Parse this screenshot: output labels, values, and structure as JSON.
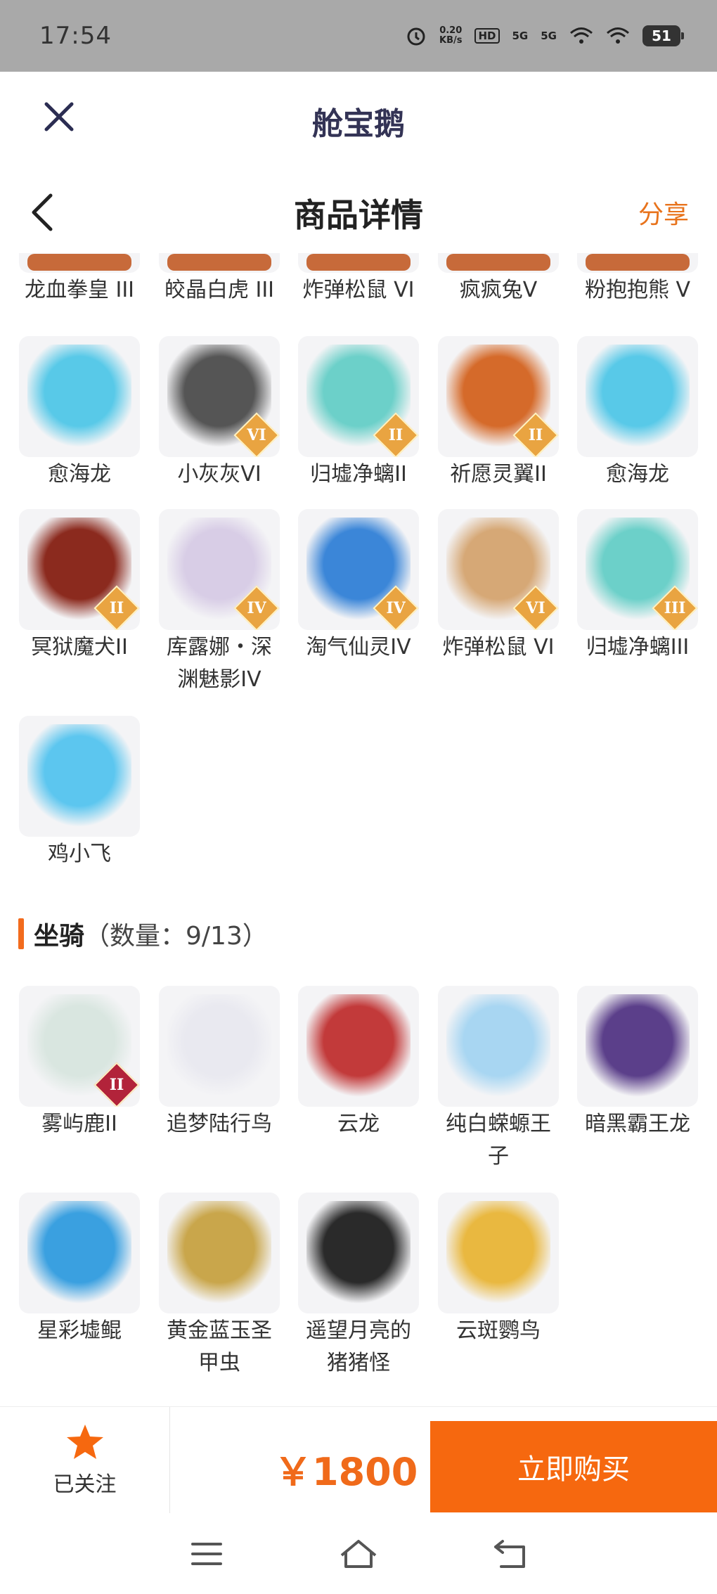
{
  "status": {
    "time": "17:54",
    "net_speed": "0.20",
    "net_unit": "KB/s",
    "hd": "HD",
    "sig1": "5G",
    "sig2": "5G",
    "battery": "51"
  },
  "app": {
    "title": "舱宝鹅"
  },
  "page": {
    "title": "商品详情",
    "share": "分享"
  },
  "pets_partial": [
    {
      "name": "龙血拳皇 III"
    },
    {
      "name": "皎晶白虎 III"
    },
    {
      "name": "炸弹松鼠 VI"
    },
    {
      "name": "疯疯兔V"
    },
    {
      "name": "粉抱抱熊 V"
    }
  ],
  "pets": [
    {
      "name": "愈海龙",
      "rank": "",
      "color": "#58c9e8"
    },
    {
      "name": "小灰灰VI",
      "rank": "VI",
      "color": "#555555"
    },
    {
      "name": "归墟净螭II",
      "rank": "II",
      "color": "#6cd0c9"
    },
    {
      "name": "祈愿灵翼II",
      "rank": "II",
      "color": "#d56a2a"
    },
    {
      "name": "愈海龙",
      "rank": "",
      "color": "#58c9e8"
    },
    {
      "name": "冥狱魔犬II",
      "rank": "II",
      "color": "#8b2a1e"
    },
    {
      "name": "库露娜・深渊魅影IV",
      "rank": "IV",
      "color": "#d8cde6"
    },
    {
      "name": "淘气仙灵IV",
      "rank": "IV",
      "color": "#3b86d8"
    },
    {
      "name": "炸弹松鼠 VI",
      "rank": "VI",
      "color": "#d6a876"
    },
    {
      "name": "归墟净螭III",
      "rank": "III",
      "color": "#6cd0c9"
    },
    {
      "name": "鸡小飞",
      "rank": "",
      "color": "#5cc6ef"
    }
  ],
  "mounts_section": {
    "label": "坐骑",
    "count": "（数量：9/13）"
  },
  "mounts": [
    {
      "name": "雾屿鹿II",
      "rank": "II",
      "color": "#d9e6e0"
    },
    {
      "name": "追梦陆行鸟",
      "rank": "",
      "color": "#e9e9f0"
    },
    {
      "name": "云龙",
      "rank": "",
      "color": "#c23a3a"
    },
    {
      "name": "纯白蝾螈王子",
      "rank": "",
      "color": "#a8d6f2"
    },
    {
      "name": "暗黑霸王龙",
      "rank": "",
      "color": "#5b3f8a"
    },
    {
      "name": "星彩墟鲲",
      "rank": "",
      "color": "#3aa0e0"
    },
    {
      "name": "黄金蓝玉圣甲虫",
      "rank": "",
      "color": "#c9a64b"
    },
    {
      "name": "遥望月亮的猪猪怪",
      "rank": "",
      "color": "#2a2a2a"
    },
    {
      "name": "云斑鹦鸟",
      "rank": "",
      "color": "#e9b840"
    }
  ],
  "bottom": {
    "follow_label": "已关注",
    "price": "￥1800",
    "buy_label": "立即购买"
  }
}
